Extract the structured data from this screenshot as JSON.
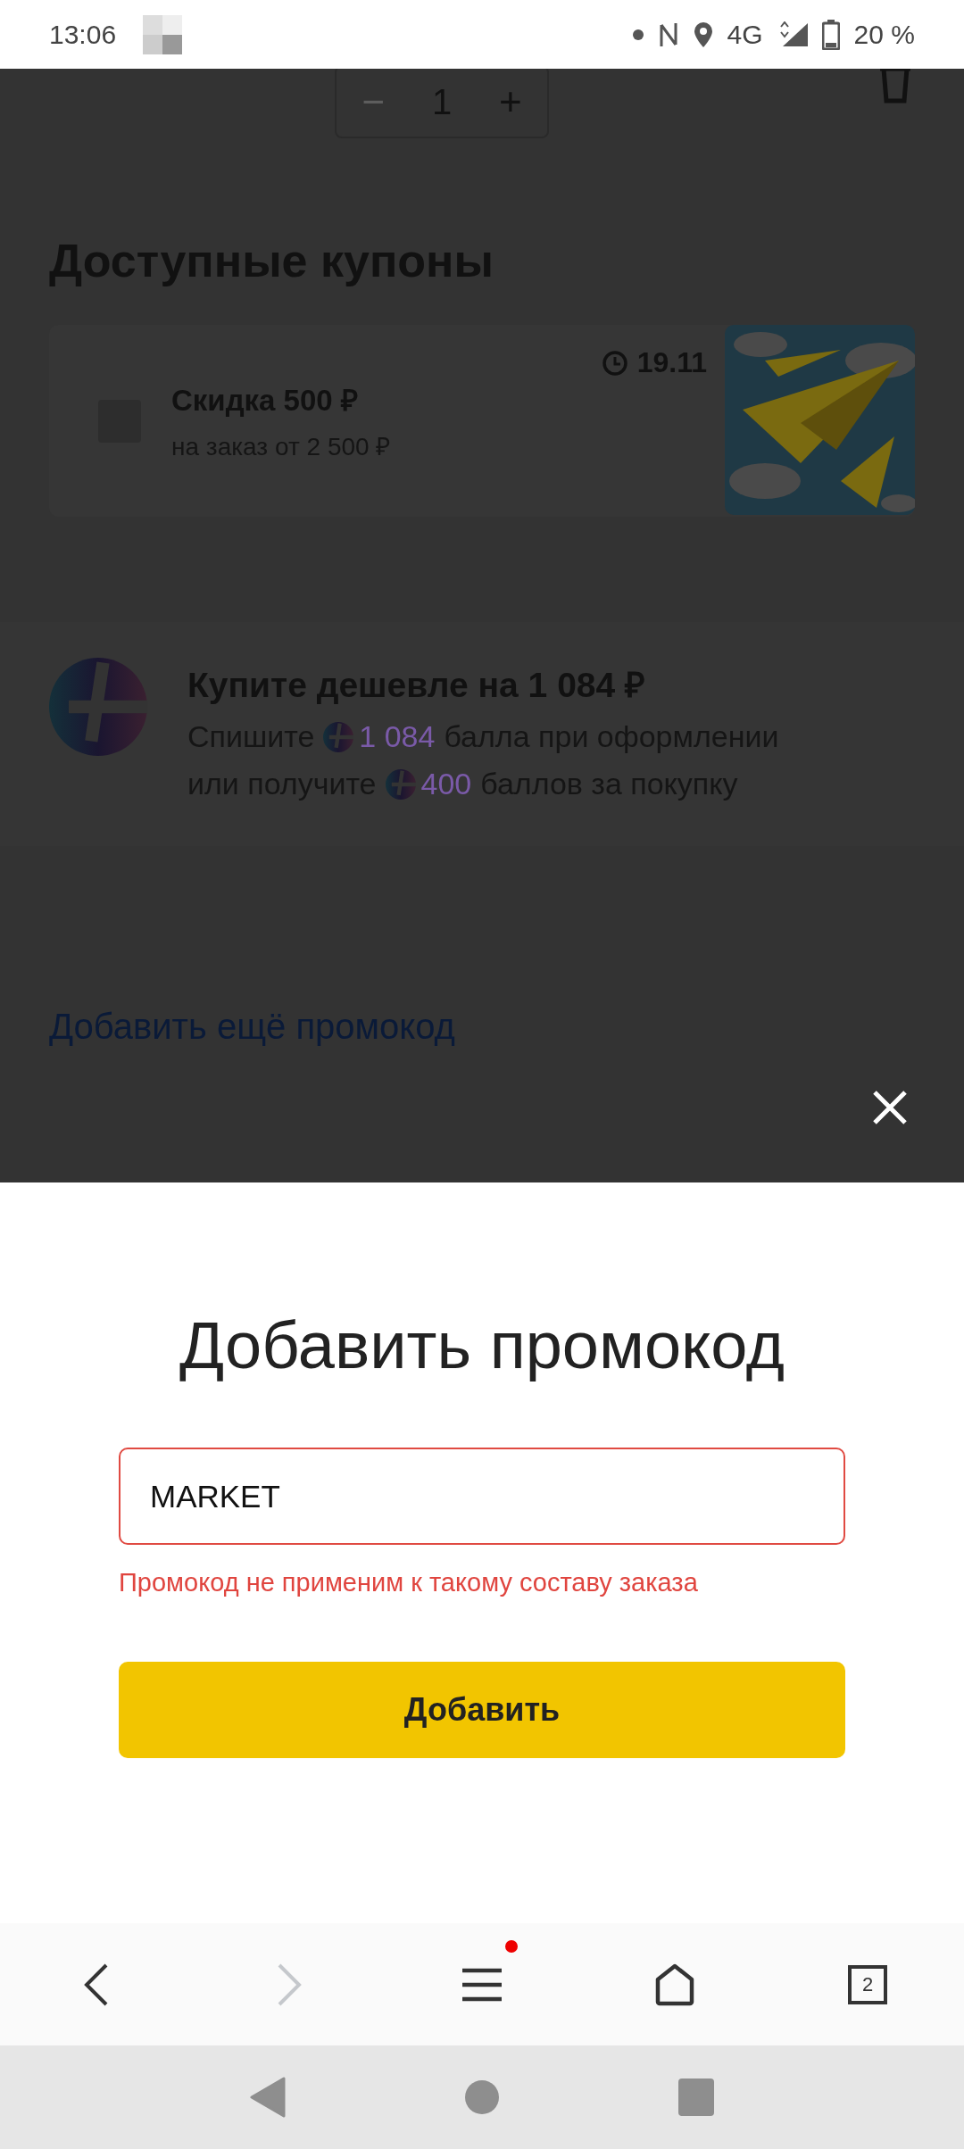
{
  "status_bar": {
    "time": "13:06",
    "network": "4G",
    "battery": "20 %"
  },
  "stepper": {
    "minus": {
      "label": "−",
      "disabled": true
    },
    "value": "1",
    "plus": {
      "label": "+",
      "disabled": false
    }
  },
  "coupons": {
    "title": "Доступные купоны",
    "items": [
      {
        "title": "Скидка 500 ₽",
        "subtitle": "на заказ от 2 500 ₽",
        "expires": "19.11",
        "checked": false
      }
    ]
  },
  "plus_offer": {
    "title": "Купите дешевле на 1 084 ₽",
    "lines": [
      [
        {
          "kind": "text",
          "text": "Спишите"
        },
        {
          "kind": "points",
          "text": "1 084"
        },
        {
          "kind": "text",
          "text": "балла при оформлении"
        }
      ],
      [
        {
          "kind": "text",
          "text": "или получите"
        },
        {
          "kind": "points",
          "text": "400"
        },
        {
          "kind": "text",
          "text": "баллов за покупку"
        }
      ]
    ]
  },
  "add_more_link": "Добавить ещё промокод",
  "sheet": {
    "title": "Добавить промокод",
    "input": {
      "value": "MARKET",
      "error": true
    },
    "error_text": "Промокод не применим к такому составу заказа",
    "button": "Добавить"
  },
  "browser_bar": {
    "back_disabled": false,
    "forward_disabled": true,
    "menu_notification": true,
    "tabs_count": "2"
  }
}
